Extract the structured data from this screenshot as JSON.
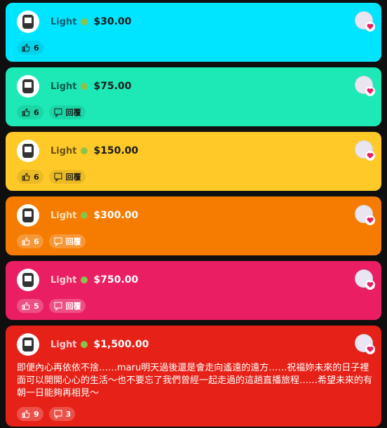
{
  "cards": [
    {
      "name": "Light",
      "amount": "$30.00",
      "likes": "6",
      "bg": "#00e5ff",
      "fg": "#1a1a1a",
      "chip": "rgba(0,0,0,0.08)",
      "reply_label": "",
      "message": ""
    },
    {
      "name": "Light",
      "amount": "$75.00",
      "likes": "6",
      "bg": "#1de9b6",
      "fg": "#1a1a1a",
      "chip": "rgba(0,0,0,0.08)",
      "reply_label": "回覆",
      "message": ""
    },
    {
      "name": "Light",
      "amount": "$150.00",
      "likes": "6",
      "bg": "#ffca28",
      "fg": "#1a1a1a",
      "chip": "rgba(0,0,0,0.08)",
      "reply_label": "回覆",
      "message": ""
    },
    {
      "name": "Light",
      "amount": "$300.00",
      "likes": "6",
      "bg": "#f57c00",
      "fg": "#ffffff",
      "chip": "rgba(255,255,255,0.22)",
      "reply_label": "回覆",
      "message": ""
    },
    {
      "name": "Light",
      "amount": "$750.00",
      "likes": "5",
      "bg": "#e91e63",
      "fg": "#ffffff",
      "chip": "rgba(255,255,255,0.22)",
      "reply_label": "回覆",
      "message": ""
    },
    {
      "name": "Light",
      "amount": "$1,500.00",
      "likes": "9",
      "bg": "#e62117",
      "fg": "#ffffff",
      "chip": "rgba(255,255,255,0.22)",
      "reply_label": "3",
      "message": "即便內心再依依不捨……maru明天過後還是會走向遙遠的遠方……祝福妳未來的日子裡面可以開開心心的生活～也不要忘了我們曾經一起走過的這趟直播旅程……希望未來的有朝一日能夠再相見～"
    }
  ],
  "icons": {
    "like": "thumbs-up-icon",
    "reply": "comment-icon",
    "heart": "heart-icon",
    "badge": "member-badge-icon"
  }
}
